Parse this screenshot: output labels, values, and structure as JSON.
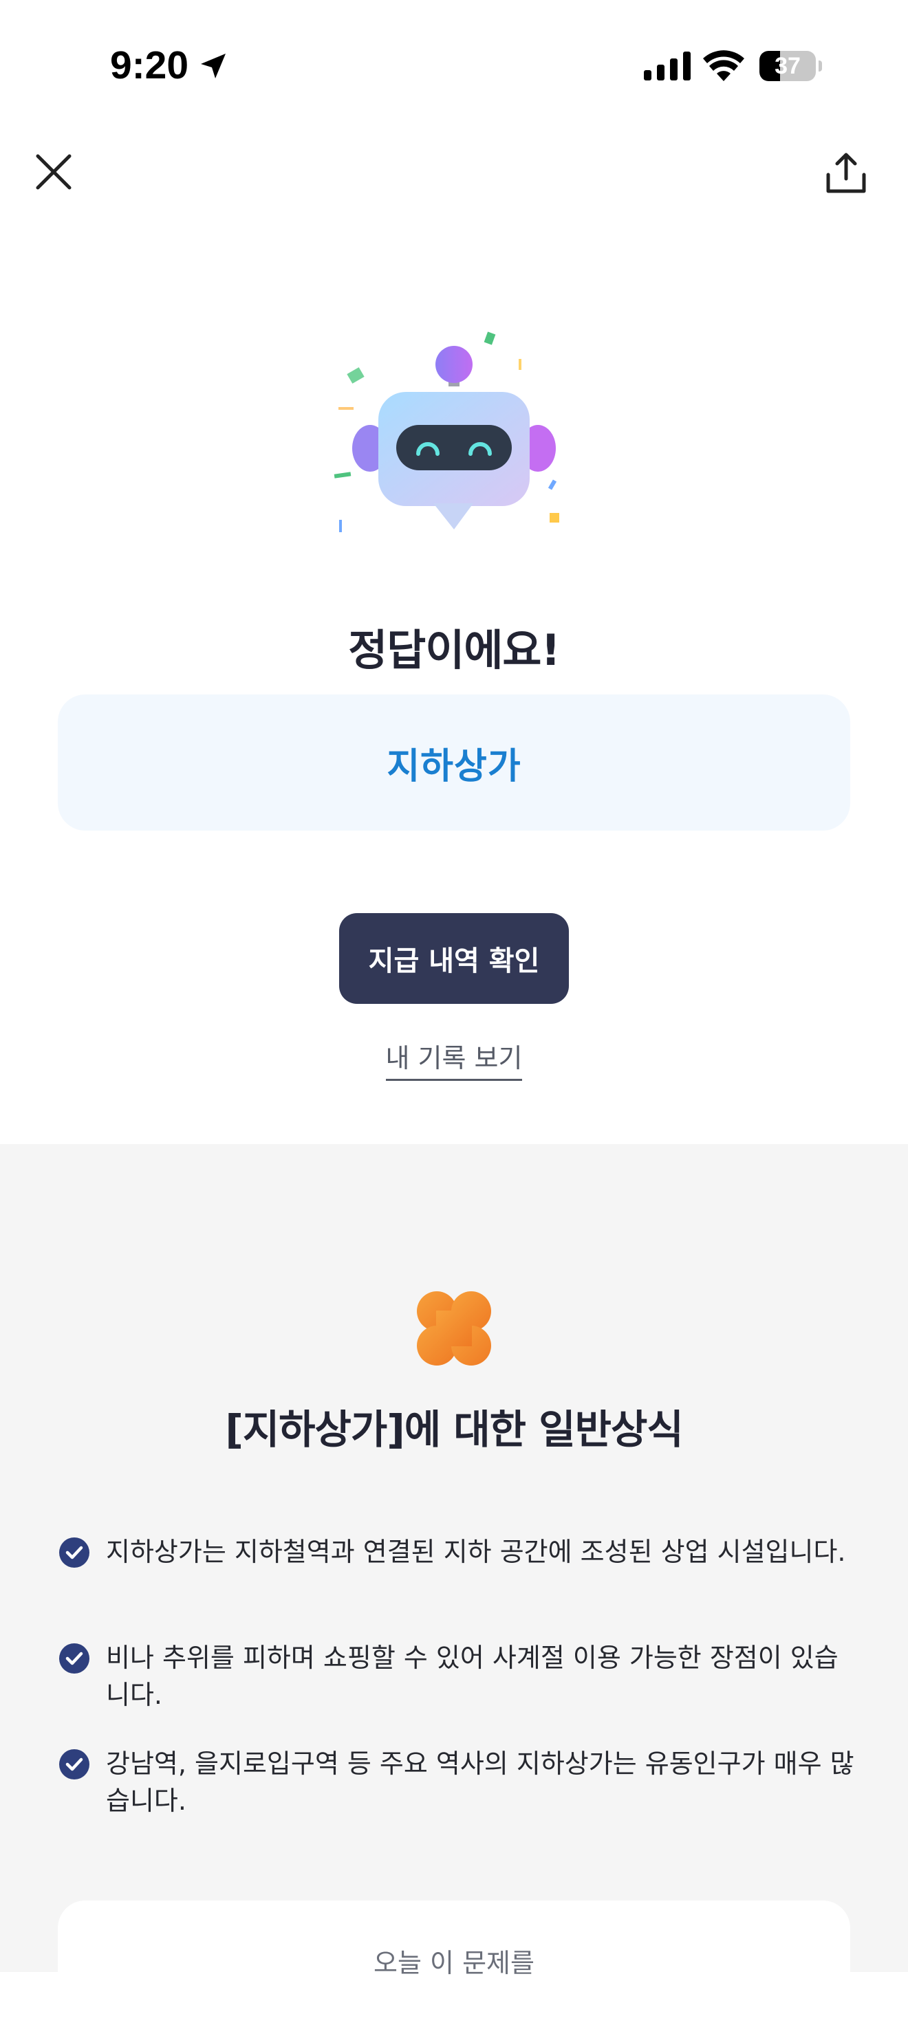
{
  "status_bar": {
    "time": "9:20",
    "battery_level": "37",
    "battery_fraction": 0.37
  },
  "nav": {
    "close_icon": "close-icon",
    "share_icon": "share-icon"
  },
  "result": {
    "title": "정답이에요!",
    "answer": "지하상가",
    "primary_button_label": "지급 내역 확인",
    "history_link_label": "내 기록 보기"
  },
  "knowledge": {
    "title": "[지하상가]에 대한 일반상식",
    "facts": [
      "지하상가는 지하철역과 연결된 지하 공간에 조성된 상업 시설입니다.",
      "비나 추위를 피하며 쇼핑할 수 있어 사계절 이용 가능한 장점이 있습니다.",
      "강남역, 을지로입구역 등 주요 역사의 지하상가는 유동인구가 매우 많습니다."
    ],
    "daily_card_text": "오늘 이 문제를"
  },
  "colors": {
    "accent_blue": "#1a7fd0",
    "answer_bg": "#f2f8fe",
    "button_bg": "#323856",
    "check_blue": "#2e3f7d",
    "clover_orange": "#f08a2c",
    "section_bg": "#f5f5f5"
  }
}
